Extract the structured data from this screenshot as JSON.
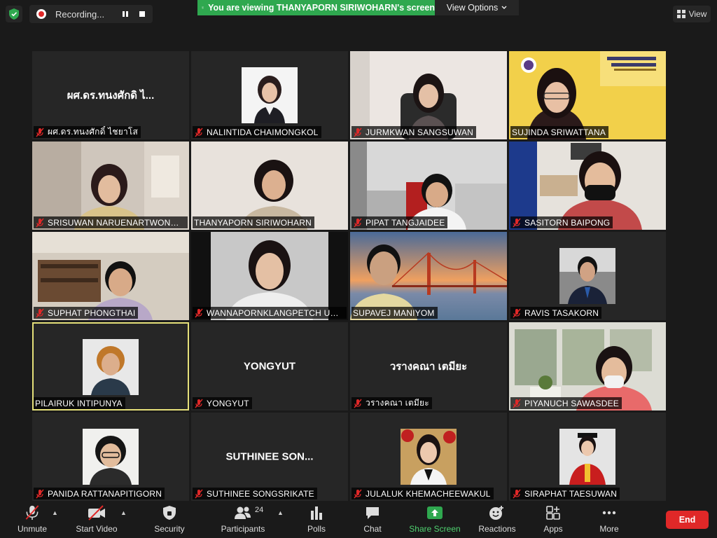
{
  "topbar": {
    "recording_label": "Recording...",
    "viewing_text": "You are viewing THANYAPORN SIRIWOHARN's screen",
    "view_options_label": "View Options",
    "view_label": "View"
  },
  "participants": [
    {
      "name": "ผศ.ดร.ทนงศักดิ์ ไชยาโส",
      "big_label": "ผศ.ดร.ทนงศักดิ ไ...",
      "muted": true
    },
    {
      "name": "NALINTIDA CHAIMONGKOL",
      "muted": true
    },
    {
      "name": "JURMKWAN SANGSUWAN",
      "muted": true
    },
    {
      "name": "SUJINDA SRIWATTANA",
      "muted": false
    },
    {
      "name": "SRISUWAN NARUENARTWONGS...",
      "muted": true
    },
    {
      "name": "THANYAPORN SIRIWOHARN",
      "muted": false
    },
    {
      "name": "PIPAT TANGJAIDEE",
      "muted": true
    },
    {
      "name": "SASITORN BAIPONG",
      "muted": true
    },
    {
      "name": "SUPHAT PHONGTHAI",
      "muted": true
    },
    {
      "name": "WANNAPORNKLANGPETCH UEN...",
      "muted": true
    },
    {
      "name": "SUPAVEJ MANIYOM",
      "muted": false
    },
    {
      "name": "RAVIS TASAKORN",
      "muted": true
    },
    {
      "name": "PILAIRUK INTIPUNYA",
      "muted": false,
      "active": true
    },
    {
      "name": "YONGYUT",
      "big_label": "YONGYUT",
      "muted": true
    },
    {
      "name": "วรางคณา เตมียะ",
      "big_label": "วรางคณา เตมียะ",
      "muted": true
    },
    {
      "name": "PIYANUCH SAWASDEE",
      "muted": true
    },
    {
      "name": "PANIDA RATTANAPITIGORN",
      "muted": true
    },
    {
      "name": "SUTHINEE SONGSRIKATE",
      "big_label": "SUTHINEE  SON...",
      "muted": true
    },
    {
      "name": "JULALUK KHEMACHEEWAKUL",
      "muted": true
    },
    {
      "name": "SIRAPHAT TAESUWAN",
      "muted": true
    }
  ],
  "toolbar": {
    "unmute": "Unmute",
    "start_video": "Start Video",
    "security": "Security",
    "participants": "Participants",
    "participants_count": "24",
    "polls": "Polls",
    "chat": "Chat",
    "share_screen": "Share Screen",
    "reactions": "Reactions",
    "apps": "Apps",
    "more": "More",
    "end": "End"
  },
  "colors": {
    "share_green": "#2fa84f",
    "end_red": "#e02828",
    "active_speaker": "#e5e07a",
    "muted_red": "#e02828"
  }
}
